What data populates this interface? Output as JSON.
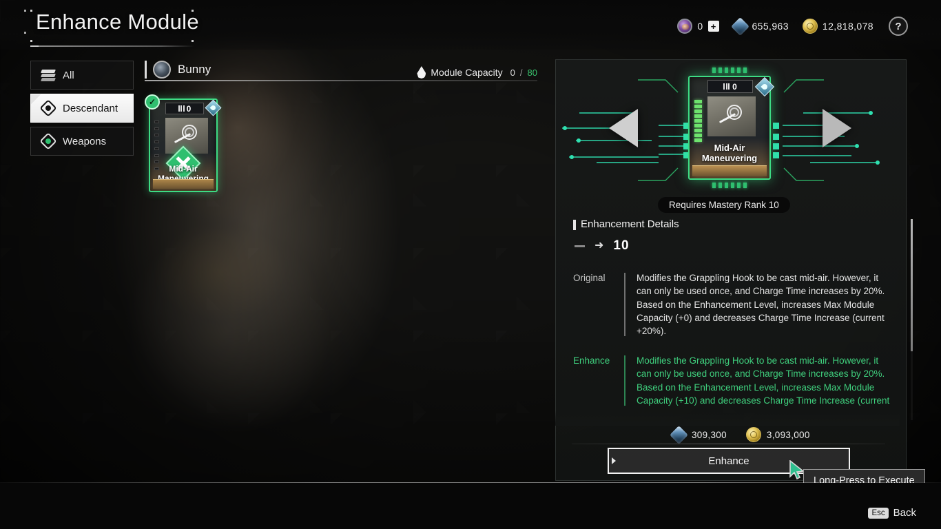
{
  "header": {
    "title": "Enhance Module",
    "help_label": "?",
    "currencies": [
      {
        "icon": "caliber-icon",
        "value": "0",
        "has_plus": true,
        "plus_label": "+"
      },
      {
        "icon": "crystal-icon",
        "value": "655,963"
      },
      {
        "icon": "gold-icon",
        "value": "12,818,078"
      }
    ]
  },
  "sidebar": {
    "items": [
      {
        "label": "All",
        "icon": "layers-icon",
        "active": false
      },
      {
        "label": "Descendant",
        "icon": "descendant-icon",
        "active": true
      },
      {
        "label": "Weapons",
        "icon": "weapons-icon",
        "active": false
      }
    ]
  },
  "module_list": {
    "descendant_name": "Bunny",
    "capacity_label": "Module Capacity",
    "capacity_current": "0",
    "capacity_separator": "/",
    "capacity_max": "80",
    "cards": [
      {
        "name": "Mid-Air Maneuvering",
        "tier": "0",
        "equipped": true,
        "check_glyph": "✓"
      }
    ]
  },
  "detail": {
    "preview_card": {
      "name": "Mid-Air Maneuvering",
      "tier": "0"
    },
    "decrease_button_label": "−",
    "increase_button_label": "+",
    "mastery_requirement": "Requires Mastery Rank 10",
    "section_title": "Enhancement Details",
    "level_from": "—",
    "level_arrow": "➜",
    "level_to": "10",
    "original": {
      "label": "Original",
      "text": "Modifies the Grappling Hook to be cast mid-air. However, it can only be used once, and Charge Time increases by 20%.\nBased on the Enhancement Level, increases Max Module Capacity (+0) and decreases Charge Time Increase (current +20%)."
    },
    "enhance": {
      "label": "Enhance",
      "text": "Modifies the Grappling Hook to be cast mid-air. However, it can only be used once, and Charge Time increases by 20%.\nBased on the Enhancement Level, increases Max Module Capacity (+10) and decreases Charge Time Increase (current"
    },
    "costs": [
      {
        "icon": "crystal-icon",
        "value": "309,300"
      },
      {
        "icon": "gold-icon",
        "value": "3,093,000"
      }
    ],
    "enhance_button_label": "Enhance",
    "tooltip": "Long-Press to Execute"
  },
  "footer": {
    "back_key": "Esc",
    "back_label": "Back"
  },
  "colors": {
    "accent_green": "#3ddc84",
    "enhance_text_green": "#3fcf7d",
    "gold": "#e3c455",
    "crystal": "#5f8fb8",
    "cursor_teal": "#2fbf8f"
  }
}
